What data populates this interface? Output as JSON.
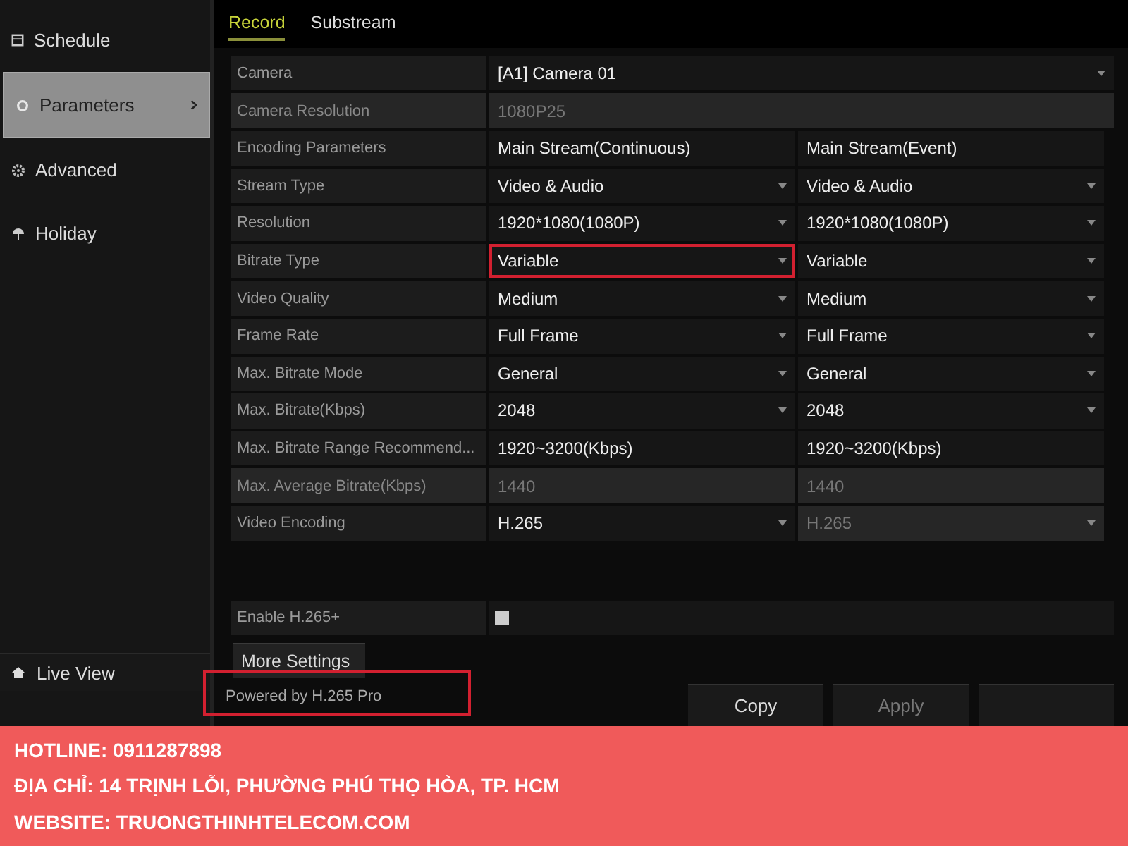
{
  "sidebar": {
    "items": [
      {
        "label": "Schedule",
        "selected": false
      },
      {
        "label": "Parameters",
        "selected": true
      },
      {
        "label": "Advanced",
        "selected": false
      },
      {
        "label": "Holiday",
        "selected": false
      }
    ],
    "live_view": {
      "label": "Live View"
    }
  },
  "tabs": [
    {
      "label": "Record",
      "selected": true
    },
    {
      "label": "Substream",
      "selected": false
    }
  ],
  "settings": [
    {
      "label": "Camera",
      "kind": "span",
      "values": [
        {
          "text": "[A1] Camera 01",
          "dropdown": true,
          "disabled": false,
          "highlighted": false
        }
      ]
    },
    {
      "label": "Camera Resolution",
      "kind": "span",
      "disabled": true,
      "values": [
        {
          "text": "1080P25",
          "dropdown": false,
          "disabled": true,
          "highlighted": false
        }
      ]
    },
    {
      "label": "Encoding Parameters",
      "kind": "pair",
      "values": [
        {
          "text": "Main Stream(Continuous)",
          "dropdown": false,
          "disabled": false,
          "highlighted": false
        },
        {
          "text": "Main Stream(Event)",
          "dropdown": false,
          "disabled": false,
          "highlighted": false
        }
      ]
    },
    {
      "label": "Stream Type",
      "kind": "pair",
      "values": [
        {
          "text": "Video & Audio",
          "dropdown": true,
          "disabled": false,
          "highlighted": false
        },
        {
          "text": "Video & Audio",
          "dropdown": true,
          "disabled": false,
          "highlighted": false
        }
      ]
    },
    {
      "label": "Resolution",
      "kind": "pair",
      "values": [
        {
          "text": "1920*1080(1080P)",
          "dropdown": true,
          "disabled": false,
          "highlighted": false
        },
        {
          "text": "1920*1080(1080P)",
          "dropdown": true,
          "disabled": false,
          "highlighted": false
        }
      ]
    },
    {
      "label": "Bitrate Type",
      "kind": "pair",
      "values": [
        {
          "text": "Variable",
          "dropdown": true,
          "disabled": false,
          "highlighted": true
        },
        {
          "text": "Variable",
          "dropdown": true,
          "disabled": false,
          "highlighted": false
        }
      ]
    },
    {
      "label": "Video Quality",
      "kind": "pair",
      "values": [
        {
          "text": "Medium",
          "dropdown": true,
          "disabled": false,
          "highlighted": false
        },
        {
          "text": "Medium",
          "dropdown": true,
          "disabled": false,
          "highlighted": false
        }
      ]
    },
    {
      "label": "Frame Rate",
      "kind": "pair",
      "values": [
        {
          "text": "Full Frame",
          "dropdown": true,
          "disabled": false,
          "highlighted": false
        },
        {
          "text": "Full Frame",
          "dropdown": true,
          "disabled": false,
          "highlighted": false
        }
      ]
    },
    {
      "label": "Max. Bitrate Mode",
      "kind": "pair",
      "values": [
        {
          "text": "General",
          "dropdown": true,
          "disabled": false,
          "highlighted": false
        },
        {
          "text": "General",
          "dropdown": true,
          "disabled": false,
          "highlighted": false
        }
      ]
    },
    {
      "label": "Max. Bitrate(Kbps)",
      "kind": "pair",
      "values": [
        {
          "text": "2048",
          "dropdown": true,
          "disabled": false,
          "highlighted": false
        },
        {
          "text": "2048",
          "dropdown": true,
          "disabled": false,
          "highlighted": false
        }
      ]
    },
    {
      "label": "Max. Bitrate Range Recommend...",
      "kind": "pair",
      "values": [
        {
          "text": "1920~3200(Kbps)",
          "dropdown": false,
          "disabled": false,
          "highlighted": false
        },
        {
          "text": "1920~3200(Kbps)",
          "dropdown": false,
          "disabled": false,
          "highlighted": false
        }
      ]
    },
    {
      "label": "Max. Average Bitrate(Kbps)",
      "kind": "pair",
      "disabled": true,
      "values": [
        {
          "text": "1440",
          "dropdown": false,
          "disabled": true,
          "highlighted": false
        },
        {
          "text": "1440",
          "dropdown": false,
          "disabled": true,
          "highlighted": false
        }
      ]
    },
    {
      "label": "Video Encoding",
      "kind": "pair",
      "values": [
        {
          "text": "H.265",
          "dropdown": true,
          "disabled": false,
          "highlighted": false
        },
        {
          "text": "H.265",
          "dropdown": true,
          "disabled": true,
          "highlighted": false
        }
      ]
    }
  ],
  "enable_h265_plus": {
    "label": "Enable H.265+",
    "checked": false
  },
  "more_settings": {
    "label": "More Settings"
  },
  "powered_by": {
    "text": "Powered by H.265 Pro",
    "highlighted": true
  },
  "buttons": [
    {
      "label": "Copy",
      "disabled": false
    },
    {
      "label": "Apply",
      "disabled": true
    }
  ],
  "footer": {
    "lines": [
      "HOTLINE: 0911287898",
      "ĐỊA CHỈ: 14 TRỊNH LỖI, PHƯỜNG PHÚ THỌ HÒA, TP. HCM",
      "WEBSITE: TRUONGTHINHTELECOM.COM"
    ]
  }
}
